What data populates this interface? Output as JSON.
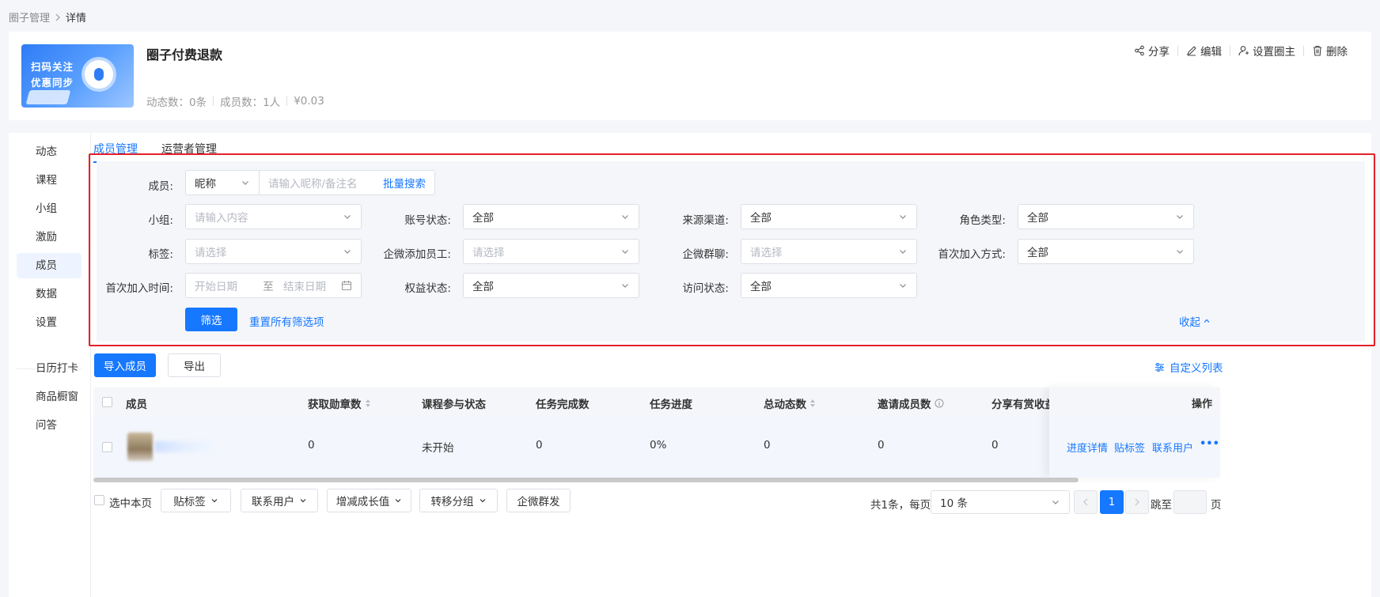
{
  "breadcrumb": {
    "parent": "圈子管理",
    "current": "详情"
  },
  "circle": {
    "cover_line1": "扫码关注",
    "cover_line2": "优惠同步",
    "title": "圈子付费退款",
    "posts_label": "动态数：0条",
    "members_label": "成员数：1人",
    "price": "¥0.03"
  },
  "header_actions": {
    "share": "分享",
    "edit": "编辑",
    "set_owner": "设置圈主",
    "delete": "删除"
  },
  "sidebar": {
    "items": [
      "动态",
      "课程",
      "小组",
      "激励",
      "成员",
      "数据",
      "设置"
    ],
    "active": "成员",
    "extra": [
      "日历打卡",
      "商品橱窗",
      "问答"
    ]
  },
  "tabs": [
    "成员管理",
    "运营者管理"
  ],
  "filters": {
    "member_label": "成员:",
    "member_type": "昵称",
    "member_placeholder": "请输入昵称/备注名",
    "batch_search": "批量搜索",
    "group_label": "小组:",
    "group_placeholder": "请输入内容",
    "account_status_label": "账号状态:",
    "account_status": "全部",
    "source_label": "来源渠道:",
    "source": "全部",
    "role_label": "角色类型:",
    "role": "全部",
    "tag_label": "标签:",
    "tag_placeholder": "请选择",
    "wecom_staff_label": "企微添加员工:",
    "wecom_staff_placeholder": "请选择",
    "wecom_group_label": "企微群聊:",
    "wecom_group_placeholder": "请选择",
    "first_join_method_label": "首次加入方式:",
    "first_join_method": "全部",
    "first_join_time_label": "首次加入时间:",
    "start_placeholder": "开始日期",
    "range_sep": "至",
    "end_placeholder": "结束日期",
    "rights_label": "权益状态:",
    "rights": "全部",
    "visit_label": "访问状态:",
    "visit": "全部",
    "filter_button": "筛选",
    "reset_link": "重置所有筛选项",
    "collapse": "收起"
  },
  "toolbar": {
    "import": "导入成员",
    "export": "导出",
    "custom_columns": "自定义列表"
  },
  "table": {
    "columns": [
      "成员",
      "获取勋章数",
      "课程参与状态",
      "任务完成数",
      "任务进度",
      "总动态数",
      "邀请成员数",
      "分享有赏收益",
      "操作"
    ],
    "rows": [
      {
        "badges": "0",
        "course_status": "未开始",
        "tasks_done": "0",
        "progress": "0%",
        "posts": "0",
        "invites": "0",
        "share_income": "0"
      }
    ],
    "row_actions": [
      "进度详情",
      "贴标签",
      "联系用户",
      "•••"
    ]
  },
  "bulk": {
    "select_page": "选中本页",
    "tag": "贴标签",
    "contact": "联系用户",
    "growth": "增减成长值",
    "move_group": "转移分组",
    "wecom_broadcast": "企微群发"
  },
  "pagination": {
    "total": "共1条，每页",
    "page_size": "10 条",
    "current_page": "1",
    "goto_label": "跳至",
    "page_unit": "页"
  },
  "colors": {
    "accent": "#1677ff",
    "highlight_border": "#e3202a"
  }
}
